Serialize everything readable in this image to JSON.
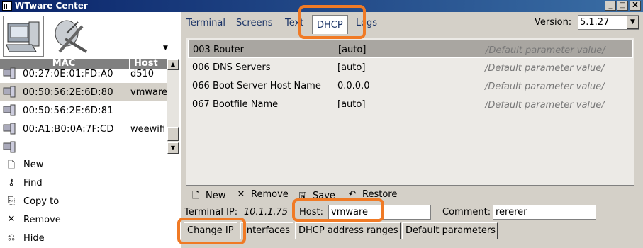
{
  "window": {
    "title": "WTware Center",
    "controls": [
      "_",
      "□",
      "X"
    ]
  },
  "left": {
    "columns": {
      "mac": "MAC",
      "host": "Host"
    },
    "rows": [
      {
        "mac": "00:27:0E:01:FD:A0",
        "host": "d510"
      },
      {
        "mac": "00:50:56:2E:6D:80",
        "host": "vmware"
      },
      {
        "mac": "00:50:56:2E:6D:81",
        "host": ""
      },
      {
        "mac": "00:A1:B0:0A:7F:CD",
        "host": "weewifi"
      }
    ],
    "actions": [
      {
        "label": "New",
        "icon": "new-doc-icon"
      },
      {
        "label": "Find",
        "icon": "key-icon"
      },
      {
        "label": "Copy to",
        "icon": "copy-icon"
      },
      {
        "label": "Remove",
        "icon": "x-icon"
      },
      {
        "label": "Hide",
        "icon": "hide-icon"
      }
    ]
  },
  "tabs": [
    "Terminal",
    "Screens",
    "Text",
    "DHCP",
    "Logs"
  ],
  "active_tab": "DHCP",
  "version": {
    "label": "Version:",
    "value": "5.1.27"
  },
  "dhcp_params": [
    {
      "name": "003 Router",
      "value": "[auto]",
      "desc": "/Default parameter value/"
    },
    {
      "name": "006 DNS Servers",
      "value": "[auto]",
      "desc": "/Default parameter value/"
    },
    {
      "name": "066 Boot Server Host Name",
      "value": "0.0.0.0",
      "desc": "/Default parameter value/"
    },
    {
      "name": "067 Bootfile Name",
      "value": "[auto]",
      "desc": "/Default parameter value/"
    }
  ],
  "param_toolbar": {
    "new": "New",
    "remove": "Remove",
    "save": "Save",
    "restore": "Restore"
  },
  "terminal": {
    "ip_label": "Terminal IP:",
    "ip_value": "10.1.1.75",
    "host_label": "Host:",
    "host_value": "vmware",
    "comment_label": "Comment:",
    "comment_value": "rererer"
  },
  "buttons": {
    "change_ip": "Change IP",
    "interfaces": "Interfaces",
    "dhcp_ranges": "DHCP address ranges",
    "default_params": "Default parameters"
  },
  "colors": {
    "titlebar": "#0a246a",
    "highlight": "#f07a25",
    "face": "#d4d0c8"
  }
}
